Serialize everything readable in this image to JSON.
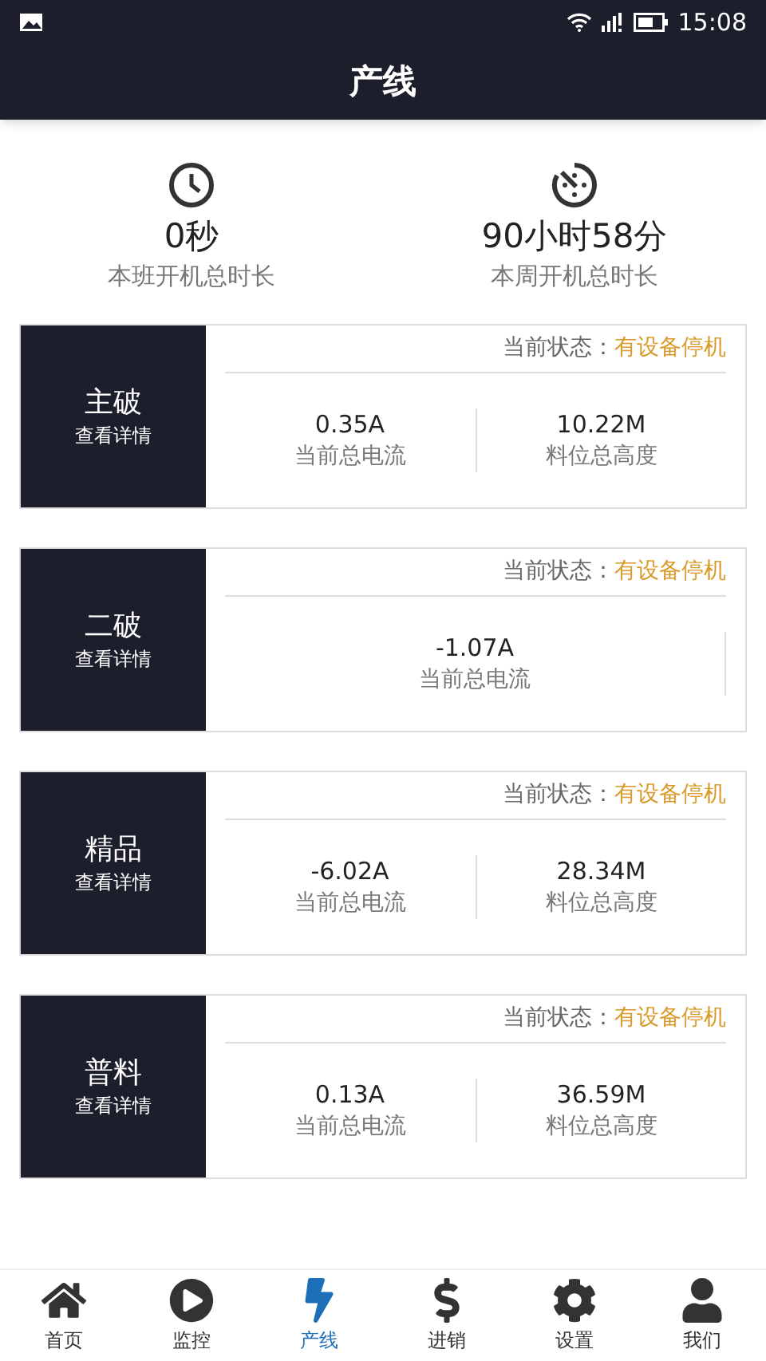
{
  "status_bar": {
    "time": "15:08"
  },
  "title": "产线",
  "stats": [
    {
      "value": "0秒",
      "label": "本班开机总时长"
    },
    {
      "value": "90小时58分",
      "label": "本周开机总时长"
    }
  ],
  "lines": [
    {
      "name": "主破",
      "link": "查看详情",
      "status_label": "当前状态：",
      "status": "有设备停机",
      "metrics": [
        {
          "value": "0.35A",
          "label": "当前总电流"
        },
        {
          "value": "10.22M",
          "label": "料位总高度"
        }
      ]
    },
    {
      "name": "二破",
      "link": "查看详情",
      "status_label": "当前状态：",
      "status": "有设备停机",
      "metrics": [
        {
          "value": "-1.07A",
          "label": "当前总电流"
        }
      ]
    },
    {
      "name": "精品",
      "link": "查看详情",
      "status_label": "当前状态：",
      "status": "有设备停机",
      "metrics": [
        {
          "value": "-6.02A",
          "label": "当前总电流"
        },
        {
          "value": "28.34M",
          "label": "料位总高度"
        }
      ]
    },
    {
      "name": "普料",
      "link": "查看详情",
      "status_label": "当前状态：",
      "status": "有设备停机",
      "metrics": [
        {
          "value": "0.13A",
          "label": "当前总电流"
        },
        {
          "value": "36.59M",
          "label": "料位总高度"
        }
      ]
    }
  ],
  "tabs": [
    {
      "label": "首页",
      "selected": false
    },
    {
      "label": "监控",
      "selected": false
    },
    {
      "label": "产线",
      "selected": true
    },
    {
      "label": "进销",
      "selected": false
    },
    {
      "label": "设置",
      "selected": false
    },
    {
      "label": "我们",
      "selected": false
    }
  ]
}
